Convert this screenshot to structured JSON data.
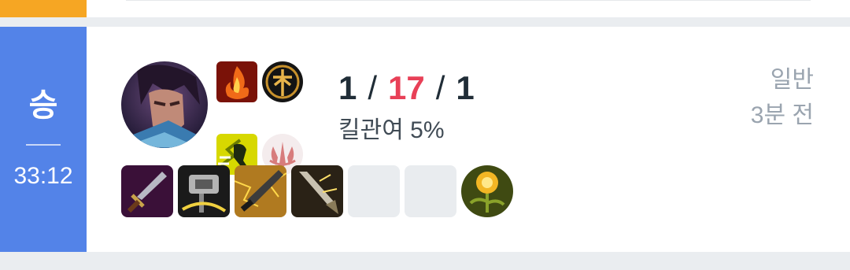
{
  "match": {
    "result": "승",
    "duration": "33:12",
    "kda": {
      "kills": "1",
      "deaths": "17",
      "assists": "1",
      "separator": "/"
    },
    "kill_participation": "킬관여 5%",
    "queue_type": "일반",
    "time_ago": "3분 전",
    "champion": "champion-portrait",
    "spells": [
      "ignite-icon",
      "ghost-icon"
    ],
    "runes": [
      "conqueror-rune-icon",
      "resolve-rune-icon"
    ],
    "items": [
      {
        "icon": "long-sword-icon",
        "empty": false
      },
      {
        "icon": "warhammer-icon",
        "empty": false
      },
      {
        "icon": "dagger-item-icon",
        "empty": false
      },
      {
        "icon": "spear-item-icon",
        "empty": false
      },
      {
        "icon": "",
        "empty": true
      },
      {
        "icon": "",
        "empty": true
      }
    ],
    "trinket": "warding-totem-icon",
    "colors": {
      "win": "#5383e8",
      "deaths": "#e84057",
      "prev_card": "#f6a623"
    }
  }
}
